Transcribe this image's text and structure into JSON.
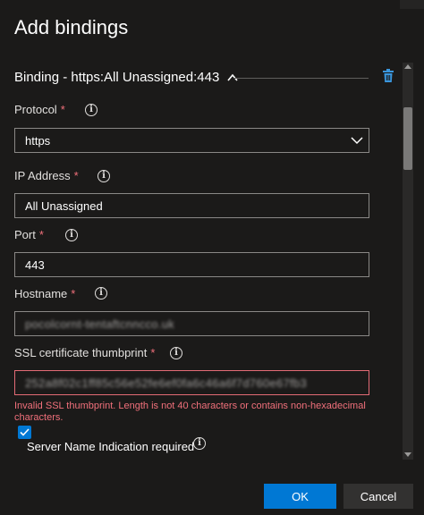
{
  "dialog": {
    "title": "Add bindings"
  },
  "binding": {
    "header": "Binding - https:All Unassigned:443"
  },
  "fields": {
    "protocol": {
      "label": "Protocol",
      "required": "*",
      "value": "https"
    },
    "ip_address": {
      "label": "IP Address",
      "required": "*",
      "value": "All Unassigned"
    },
    "port": {
      "label": "Port",
      "required": "*",
      "value": "443"
    },
    "hostname": {
      "label": "Hostname",
      "required": "*",
      "value": "pocolcornt-tentaftcnncco.uk"
    },
    "ssl_thumbprint": {
      "label": "SSL certificate thumbprint",
      "required": "*",
      "value": "252a8f02c1ff85c56e52fe6ef0fa6c46a6f7d760e67fb3",
      "error": "Invalid SSL thumbprint. Length is not 40 characters or contains non-hexadecimal characters."
    }
  },
  "sni": {
    "label": "Server Name Indication required",
    "checked": true
  },
  "info_glyph": "i",
  "buttons": {
    "ok": "OK",
    "cancel": "Cancel"
  },
  "colors": {
    "accent": "#0078d4",
    "error": "#f1707b",
    "background": "#1b1a19"
  },
  "icons": {
    "collapse": "chevron-up-icon",
    "delete": "trash-icon",
    "info": "info-icon",
    "dropdown": "chevron-down-icon",
    "check": "checkmark-icon"
  }
}
